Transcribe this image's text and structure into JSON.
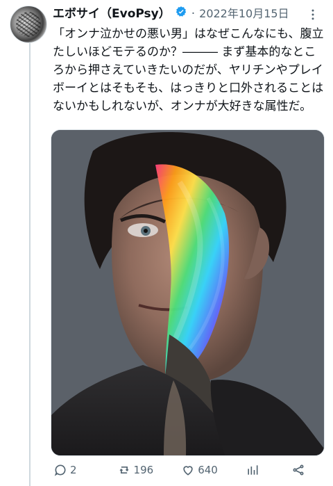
{
  "author": {
    "display_name": "エボサイ（EvoPsy）",
    "verified": true
  },
  "separator": "·",
  "timestamp": "2022年10月15日",
  "tweet_text": "「オンナ泣かせの悪い男」はなぜこんなにも、腹立たしいほどモテるのか？――― まず基本的なところから押さえていきたいのだが、ヤリチンやプレイボーイとはそもそも、はっきりと口外されることはないかもしれないが、オンナが大好きな属性だ。",
  "actions": {
    "reply_count": "2",
    "retweet_count": "196",
    "like_count": "640"
  },
  "colors": {
    "text": "#0f1419",
    "secondary_text": "#536471",
    "verified_blue": "#1d9bf0",
    "thread_line": "#cfd9de",
    "border": "#e1e8ed"
  },
  "icons": {
    "verified": "verified-badge-icon",
    "more": "more-options-icon",
    "reply": "reply-icon",
    "retweet": "retweet-icon",
    "like": "like-icon",
    "views": "views-icon",
    "share": "share-icon"
  }
}
